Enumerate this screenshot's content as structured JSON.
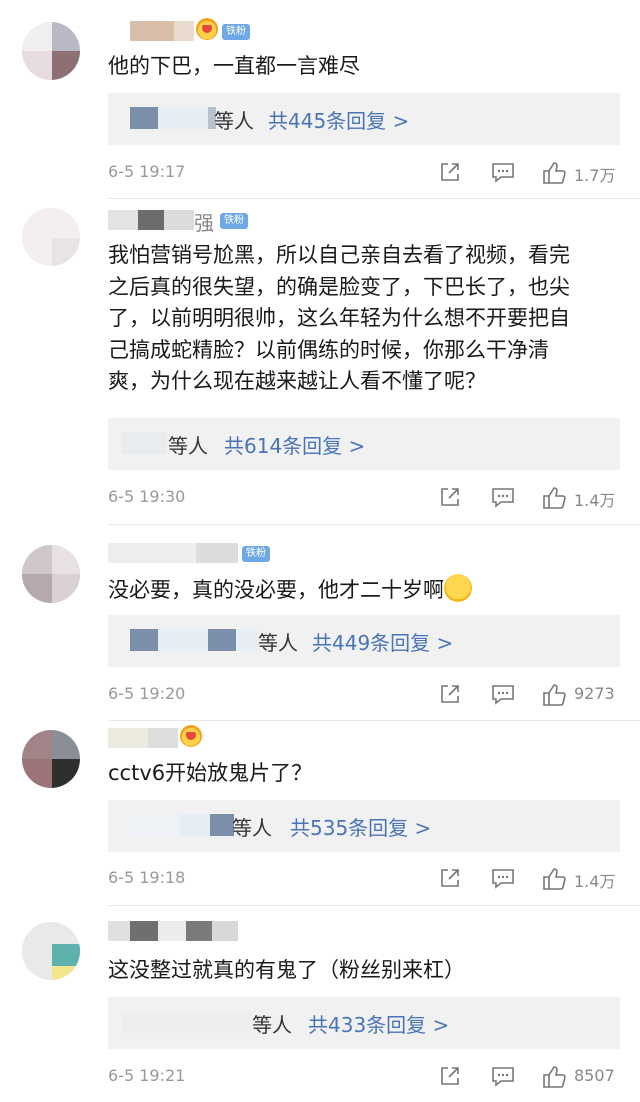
{
  "comments": [
    {
      "text": "他的下巴，一直都一言难尽",
      "reply_who": "等人",
      "reply_count": "共445条回复 >",
      "time": "6-5 19:17",
      "likes": "1.7万"
    },
    {
      "username_visible": "强",
      "badge": "铁粉",
      "text_lines": [
        "我怕营销号尬黑，所以自己亲自去看了视频，看完",
        "之后真的很失望，的确是脸变了，下巴长了，也尖",
        "了，以前明明很帅，这么年轻为什么想不开要把自",
        "己搞成蛇精脸？以前偶练的时候，你那么干净清",
        "爽，为什么现在越来越让人看不懂了呢？"
      ],
      "reply_who": "等人",
      "reply_count": "共614条回复 >",
      "time": "6-5 19:30",
      "likes": "1.4万"
    },
    {
      "badge": "铁粉",
      "text": "没必要，真的没必要，他才二十岁啊",
      "reply_who": "等人",
      "reply_count": "共449条回复 >",
      "time": "6-5 19:20",
      "likes": "9273"
    },
    {
      "text": "cctv6开始放鬼片了？",
      "reply_who": "等人",
      "reply_count": "共535条回复 >",
      "time": "6-5 19:18",
      "likes": "1.4万"
    },
    {
      "text": "这没整过就真的有鬼了（粉丝别来杠）",
      "reply_who": "等人",
      "reply_count": "共433条回复 >",
      "time": "6-5 19:21",
      "likes": "8507"
    }
  ],
  "colors": {
    "reply_link": "#4a74b8",
    "badge": "#6fa8e4",
    "meta_gray": "#999999",
    "reply_bg": "#f1f1f1"
  }
}
